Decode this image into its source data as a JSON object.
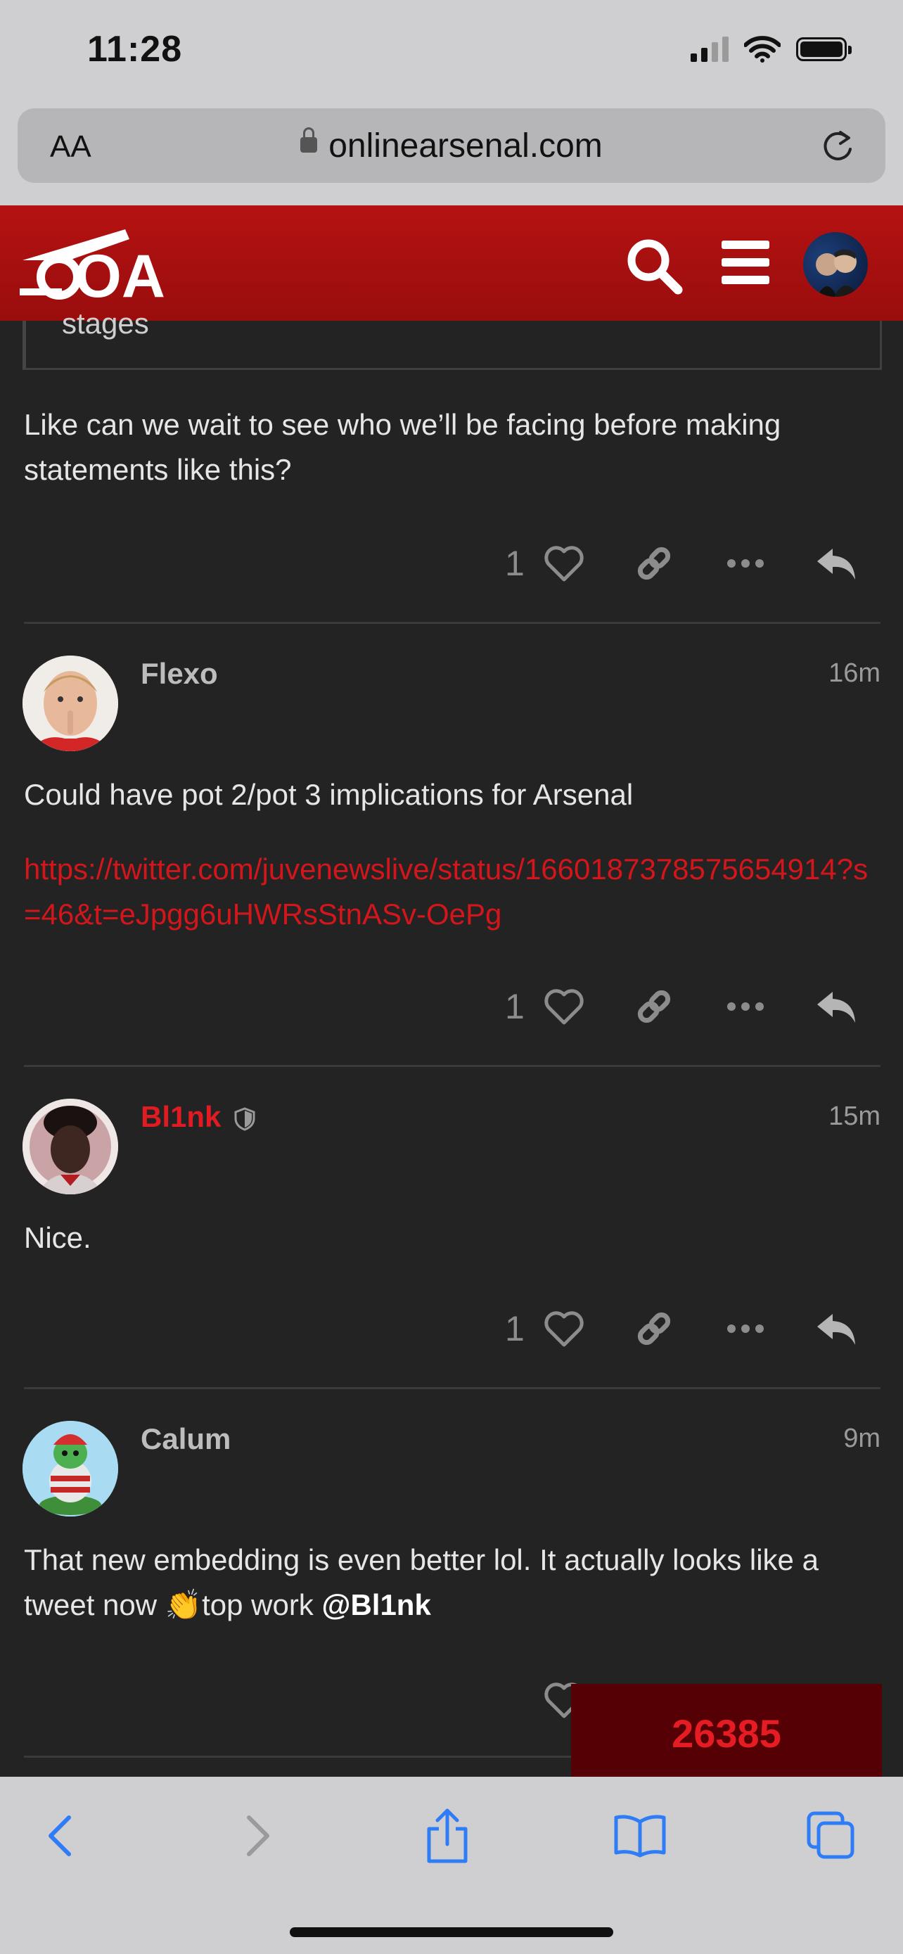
{
  "status_bar": {
    "time": "11:28"
  },
  "browser": {
    "text_size_label": "AA",
    "url": "onlinearsenal.com"
  },
  "site": {
    "logo_text": "OA"
  },
  "quote": {
    "trailing_text": "stages"
  },
  "posts": [
    {
      "id": "prev",
      "body": "Like can we wait to see who we’ll be facing before making statements like this?",
      "likes": "1"
    },
    {
      "id": "flexo",
      "username": "Flexo",
      "time": "16m",
      "body": "Could have pot 2/pot 3 implications for Arsenal",
      "link": "https://twitter.com/juvenewslive/status/1660187378575654914?s=46&t=eJpgg6uHWRsStnASv-OePg",
      "likes": "1"
    },
    {
      "id": "bl1nk",
      "username": "Bl1nk",
      "time": "15m",
      "body": "Nice.",
      "likes": "1"
    },
    {
      "id": "calum",
      "username": "Calum",
      "time": "9m",
      "body_pre": "That new embedding is even better lol. It actually looks like a tweet now ",
      "emoji": "👏",
      "body_mid": "top work ",
      "mention": "@Bl1nk"
    }
  ],
  "counter": {
    "value": "26385"
  },
  "colors": {
    "brand_red": "#b51212",
    "link_red": "#d3161b",
    "background": "#232323"
  }
}
